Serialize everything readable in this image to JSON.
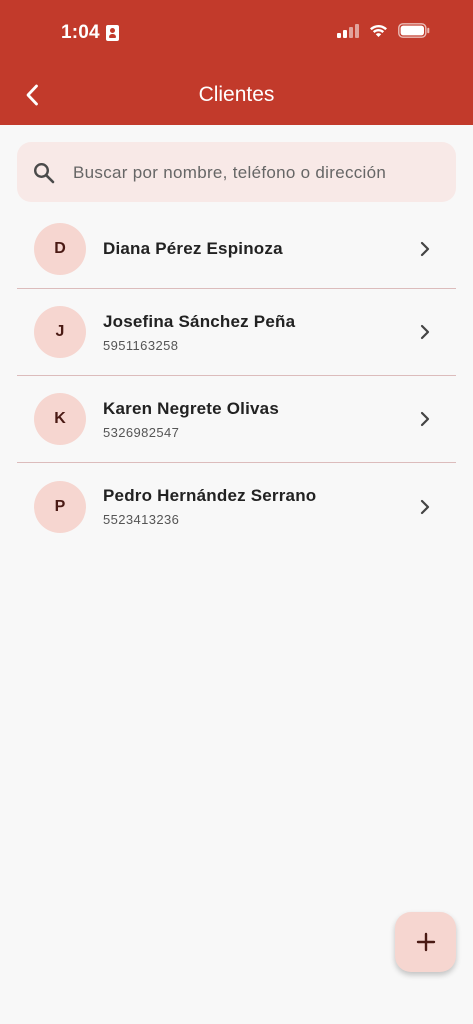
{
  "status_bar": {
    "time": "1:04"
  },
  "header": {
    "title": "Clientes"
  },
  "search": {
    "placeholder": "Buscar por nombre, teléfono o dirección"
  },
  "clients": [
    {
      "initial": "D",
      "name": "Diana Pérez Espinoza",
      "phone": ""
    },
    {
      "initial": "J",
      "name": "Josefina Sánchez Peña",
      "phone": "5951163258"
    },
    {
      "initial": "K",
      "name": "Karen Negrete Olivas",
      "phone": "5326982547"
    },
    {
      "initial": "P",
      "name": "Pedro Hernández Serrano",
      "phone": "5523413236"
    }
  ],
  "colors": {
    "brand": "#c23a2b",
    "avatar_bg": "#f6d6d0",
    "search_bg": "#f8e9e7"
  },
  "icons": {
    "back": "chevron-left-icon",
    "search": "search-icon",
    "row": "chevron-right-icon",
    "fab": "plus-icon"
  }
}
